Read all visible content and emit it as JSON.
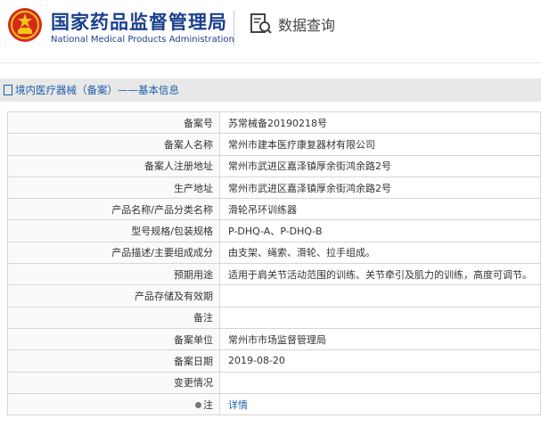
{
  "header": {
    "title_cn": "国家药品监督管理局",
    "title_en": "National Medical Products Administration",
    "query_label": "数据查询"
  },
  "breadcrumb": {
    "text": "境内医疗器械（备案）——基本信息"
  },
  "rows": [
    {
      "label": "备案号",
      "value": "苏常械备20190218号"
    },
    {
      "label": "备案人名称",
      "value": "常州市建本医疗康复器材有限公司"
    },
    {
      "label": "备案人注册地址",
      "value": "常州市武进区嘉泽镇厚余街鸿余路2号"
    },
    {
      "label": "生产地址",
      "value": "常州市武进区嘉泽镇厚余街鸿余路2号"
    },
    {
      "label": "产品名称/产品分类名称",
      "value": "滑轮吊环训练器"
    },
    {
      "label": "型号规格/包装规格",
      "value": "P-DHQ-A、P-DHQ-B"
    },
    {
      "label": "产品描述/主要组成成分",
      "value": "由支架、绳索、滑轮、拉手组成。"
    },
    {
      "label": "预期用途",
      "value": "适用于肩关节活动范围的训练、关节牵引及肌力的训练，高度可调节。"
    },
    {
      "label": "产品存储及有效期",
      "value": ""
    },
    {
      "label": "备注",
      "value": ""
    },
    {
      "label": "备案单位",
      "value": "常州市市场监督管理局"
    },
    {
      "label": "备案日期",
      "value": "2019-08-20"
    },
    {
      "label": "变更情况",
      "value": ""
    },
    {
      "label": "注",
      "value": "详情"
    }
  ],
  "colors": {
    "brand_blue": "#1a3f8c",
    "link_blue": "#1a5fa8",
    "emblem_red": "#d42a1e",
    "emblem_gold": "#f5c518"
  }
}
